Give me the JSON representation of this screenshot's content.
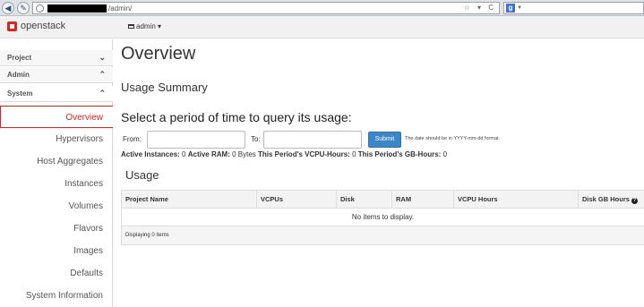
{
  "browser": {
    "url_path": "/admin/",
    "url_icons": "☆ ▾ C",
    "search_icon": "google-icon",
    "back_icon": "back-arrow-icon",
    "tools_icon": "wrench-icon"
  },
  "topbar": {
    "logo_text": "openstack",
    "project_menu": "admin",
    "project_menu_caret": "▾"
  },
  "sidebar": {
    "accordions": [
      {
        "label": "Project",
        "chevron": "⌄"
      },
      {
        "label": "Admin",
        "chevron": "⌃"
      },
      {
        "label": "System",
        "chevron": "⌃"
      }
    ],
    "items": [
      {
        "label": "Overview",
        "active": true
      },
      {
        "label": "Hypervisors"
      },
      {
        "label": "Host Aggregates"
      },
      {
        "label": "Instances"
      },
      {
        "label": "Volumes"
      },
      {
        "label": "Flavors"
      },
      {
        "label": "Images"
      },
      {
        "label": "Defaults"
      },
      {
        "label": "System Information"
      }
    ]
  },
  "main": {
    "title": "Overview",
    "summary_heading": "Usage Summary",
    "query_heading": "Select a period of time to query its usage:",
    "from_label": "From:",
    "to_label": "To:",
    "from_value": "",
    "to_value": "",
    "submit_label": "Submit",
    "date_hint": "The date should be in YYYY-mm-dd format.",
    "stats": {
      "active_instances_label": "Active Instances:",
      "active_instances": "0",
      "active_ram_label": "Active RAM:",
      "active_ram": "0 Bytes",
      "vcpu_hours_label": "This Period's VCPU-Hours:",
      "vcpu_hours": "0",
      "gb_hours_label": "This Period's GB-Hours:",
      "gb_hours": "0"
    },
    "usage_heading": "Usage",
    "table": {
      "columns": [
        "Project Name",
        "VCPUs",
        "Disk",
        "RAM",
        "VCPU Hours",
        "Disk GB Hours"
      ],
      "empty_message": "No items to display.",
      "footer": "Displaying 0 items"
    }
  }
}
